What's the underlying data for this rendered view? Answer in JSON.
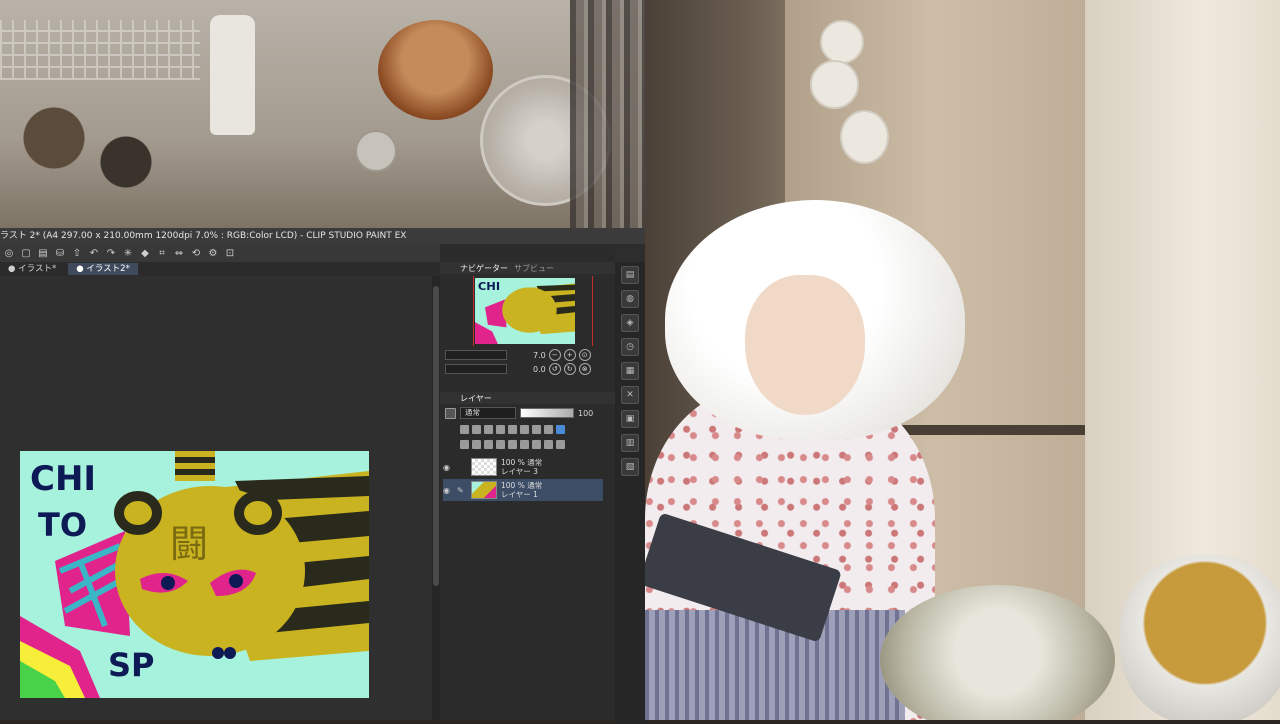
{
  "window": {
    "title": "ラスト 2* (A4 297.00 x 210.00mm 1200dpi 7.0% : RGB:Color LCD)  - CLIP STUDIO PAINT EX"
  },
  "toolbar": {
    "icons": [
      "new-file-icon",
      "open-icon",
      "save-icon",
      "upload-icon",
      "undo-icon",
      "redo-icon",
      "transform-icon",
      "fill-icon",
      "crop-icon",
      "flip-icon",
      "rotate-icon",
      "settings-icon",
      "reference-icon"
    ]
  },
  "tabs": [
    {
      "label": "イラスト*",
      "active": false
    },
    {
      "label": "イラスト2*",
      "active": true
    }
  ],
  "artwork": {
    "line1": "CHI",
    "line2": "TO",
    "line3": "SP",
    "glyph": "闘"
  },
  "navigator": {
    "tab_label": "ナビゲーター",
    "sub_tab_label": "サブビュー",
    "zoom": "7.0",
    "rotation": "0.0"
  },
  "layers_panel": {
    "tab_label": "レイヤー",
    "blend_mode": "通常",
    "opacity": "100",
    "items": [
      {
        "opacity_mode": "100 % 通常",
        "name": "レイヤー 3",
        "thumbnail": "checker",
        "selected": false
      },
      {
        "opacity_mode": "100 % 通常",
        "name": "レイヤー 1",
        "thumbnail": "artwork",
        "selected": true
      }
    ]
  },
  "colors": {
    "canvas_bg": "#a6f2dc",
    "tiger_yellow": "#c9b320",
    "stripe_dark": "#2a2a1c",
    "accent_pink": "#e0248c",
    "text_navy": "#0e1a55",
    "selected_layer": "#3e4d66"
  }
}
